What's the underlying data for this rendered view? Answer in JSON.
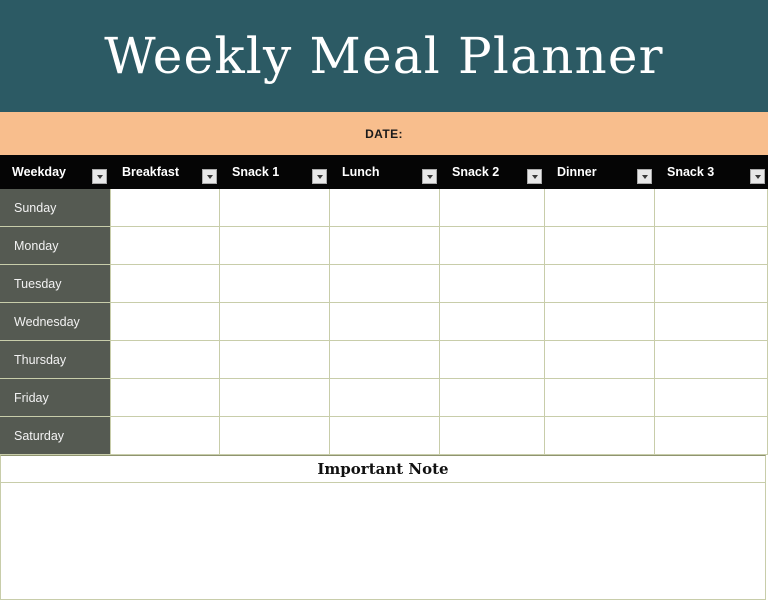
{
  "document": {
    "title": "Weekly Meal Planner",
    "date_label": "DATE:",
    "note_heading": "Important Note",
    "note_value": ""
  },
  "colors": {
    "title_banner": "#2c5a64",
    "date_bar": "#f8be8d",
    "header_row": "#050505",
    "weekday_cell": "#555a52",
    "grid_line": "#c8cdaa",
    "title_text": "#ffffff",
    "header_text": "#ffffff",
    "weekday_text": "#f2f2f2"
  },
  "table": {
    "columns": [
      {
        "label": "Weekday",
        "filter_icon": "filter-dropdown-icon",
        "has_filter": true
      },
      {
        "label": "Breakfast",
        "filter_icon": "filter-dropdown-icon",
        "has_filter": true
      },
      {
        "label": "Snack 1",
        "filter_icon": "filter-dropdown-icon",
        "has_filter": true
      },
      {
        "label": "Lunch",
        "filter_icon": "filter-dropdown-icon",
        "has_filter": true
      },
      {
        "label": "Snack 2",
        "filter_icon": "filter-dropdown-icon",
        "has_filter": true
      },
      {
        "label": "Dinner",
        "filter_icon": "filter-dropdown-icon",
        "has_filter": true
      },
      {
        "label": "Snack 3",
        "filter_icon": "filter-dropdown-icon",
        "has_filter": true
      }
    ],
    "rows": [
      {
        "weekday": "Sunday",
        "cells": [
          "",
          "",
          "",
          "",
          "",
          ""
        ]
      },
      {
        "weekday": "Monday",
        "cells": [
          "",
          "",
          "",
          "",
          "",
          ""
        ]
      },
      {
        "weekday": "Tuesday",
        "cells": [
          "",
          "",
          "",
          "",
          "",
          ""
        ]
      },
      {
        "weekday": "Wednesday",
        "cells": [
          "",
          "",
          "",
          "",
          "",
          ""
        ]
      },
      {
        "weekday": "Thursday",
        "cells": [
          "",
          "",
          "",
          "",
          "",
          ""
        ]
      },
      {
        "weekday": "Friday",
        "cells": [
          "",
          "",
          "",
          "",
          "",
          ""
        ]
      },
      {
        "weekday": "Saturday",
        "cells": [
          "",
          "",
          "",
          "",
          "",
          ""
        ]
      }
    ]
  }
}
